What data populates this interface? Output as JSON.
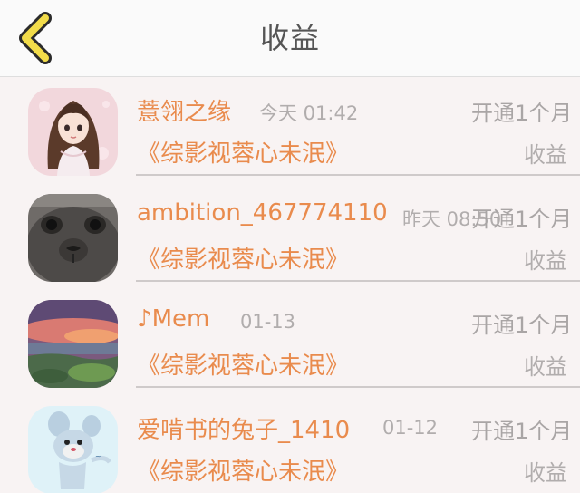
{
  "header": {
    "title": "收益",
    "back_icon": "chevron-left-icon",
    "accent_color": "#f2dc4a"
  },
  "colors": {
    "nickname": "#e98b4d",
    "muted": "#b1adad",
    "background": "#f8f3f3"
  },
  "records": [
    {
      "nickname": "薏翎之缘",
      "time": "今天 01:42",
      "action": "开通1个月",
      "book": "《综影视蓉心未泯》",
      "income_label": "收益",
      "avatar": "anime-girl-avatar"
    },
    {
      "nickname": "ambition_467774110",
      "time": "昨天 08:50",
      "action": "开通1个月",
      "book": "《综影视蓉心未泯》",
      "income_label": "收益",
      "avatar": "cat-avatar"
    },
    {
      "nickname": "♪Mem",
      "time": "01-13",
      "action": "开通1个月",
      "book": "《综影视蓉心未泯》",
      "income_label": "收益",
      "avatar": "sunset-landscape-avatar"
    },
    {
      "nickname": "爱啃书的兔子_1410",
      "time": "01-12",
      "action": "开通1个月",
      "book": "《综影视蓉心未泯》",
      "income_label": "收益",
      "avatar": "cartoon-mouse-avatar"
    }
  ]
}
